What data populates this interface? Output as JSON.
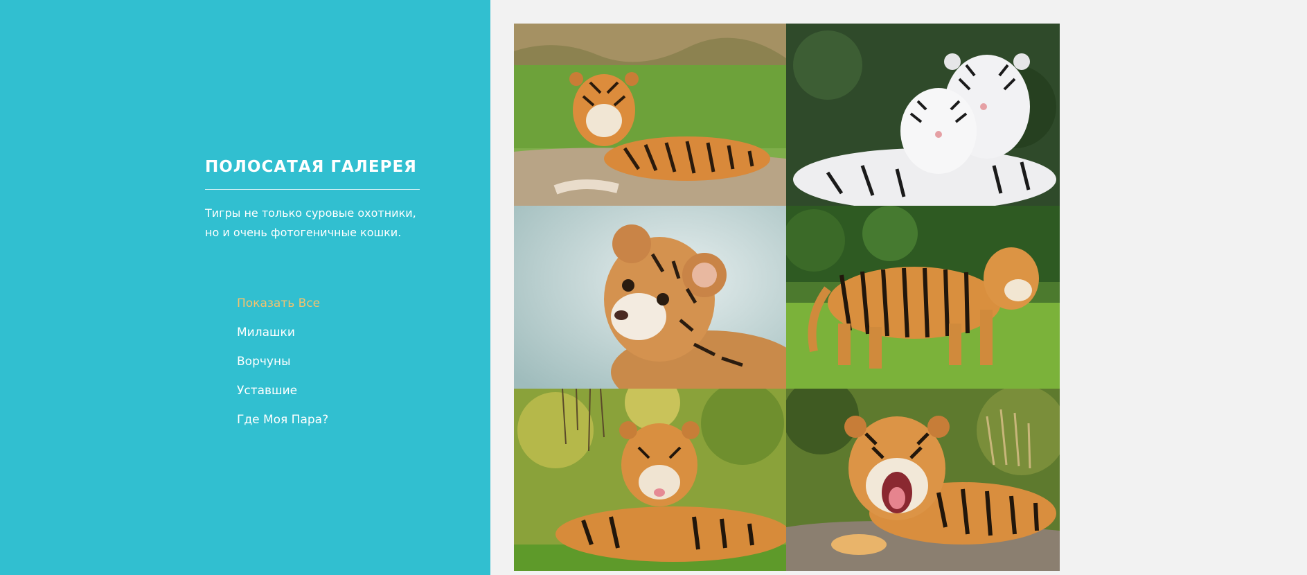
{
  "sidebar": {
    "title": "ПОЛОСАТАЯ ГАЛЕРЕЯ",
    "description": "Тигры не только суровые охотники, но и очень фотогеничные кошки.",
    "filters": [
      {
        "label": "Показать Все",
        "active": true
      },
      {
        "label": "Милашки",
        "active": false
      },
      {
        "label": "Ворчуны",
        "active": false
      },
      {
        "label": "Уставшие",
        "active": false
      },
      {
        "label": "Где Моя Пара?",
        "active": false
      }
    ]
  },
  "gallery": {
    "photos": [
      {
        "subject": "tiger lying on rock"
      },
      {
        "subject": "two white tigers"
      },
      {
        "subject": "tiger cub"
      },
      {
        "subject": "walking tiger"
      },
      {
        "subject": "tiger lying in grass"
      },
      {
        "subject": "roaring tiger"
      }
    ]
  },
  "colors": {
    "sidebar_bg": "#31bfd0",
    "accent": "#f6c26b",
    "page_bg": "#f2f2f2"
  }
}
